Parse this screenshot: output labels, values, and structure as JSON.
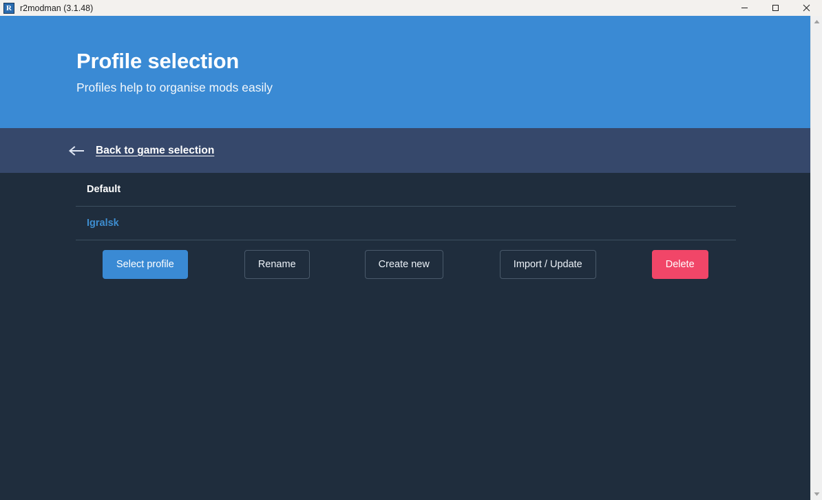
{
  "window": {
    "title": "r2modman (3.1.48)",
    "app_icon": "r-logo-icon",
    "controls": {
      "minimize": "minimize-icon",
      "maximize": "maximize-icon",
      "close": "close-icon"
    }
  },
  "hero": {
    "title": "Profile selection",
    "subtitle": "Profiles help to organise mods easily",
    "background_color": "#3a8ad4"
  },
  "navbar": {
    "back_label": "Back to game selection",
    "back_icon": "arrow-left-icon",
    "background_color": "#36486b"
  },
  "main": {
    "background_color": "#1f2d3d",
    "profiles": [
      {
        "name": "Default",
        "selected": true
      },
      {
        "name": "Igralsk",
        "selected": false
      }
    ],
    "buttons": [
      {
        "label": "Select profile",
        "style": "primary",
        "color": "#3a8ad4"
      },
      {
        "label": "Rename",
        "style": "outline",
        "color": "#4a5a6b"
      },
      {
        "label": "Create new",
        "style": "outline",
        "color": "#4a5a6b"
      },
      {
        "label": "Import / Update",
        "style": "outline",
        "color": "#4a5a6b"
      },
      {
        "label": "Delete",
        "style": "danger",
        "color": "#f14668"
      }
    ]
  },
  "scrollbar": {
    "up_icon": "caret-up-icon",
    "down_icon": "caret-down-icon"
  }
}
